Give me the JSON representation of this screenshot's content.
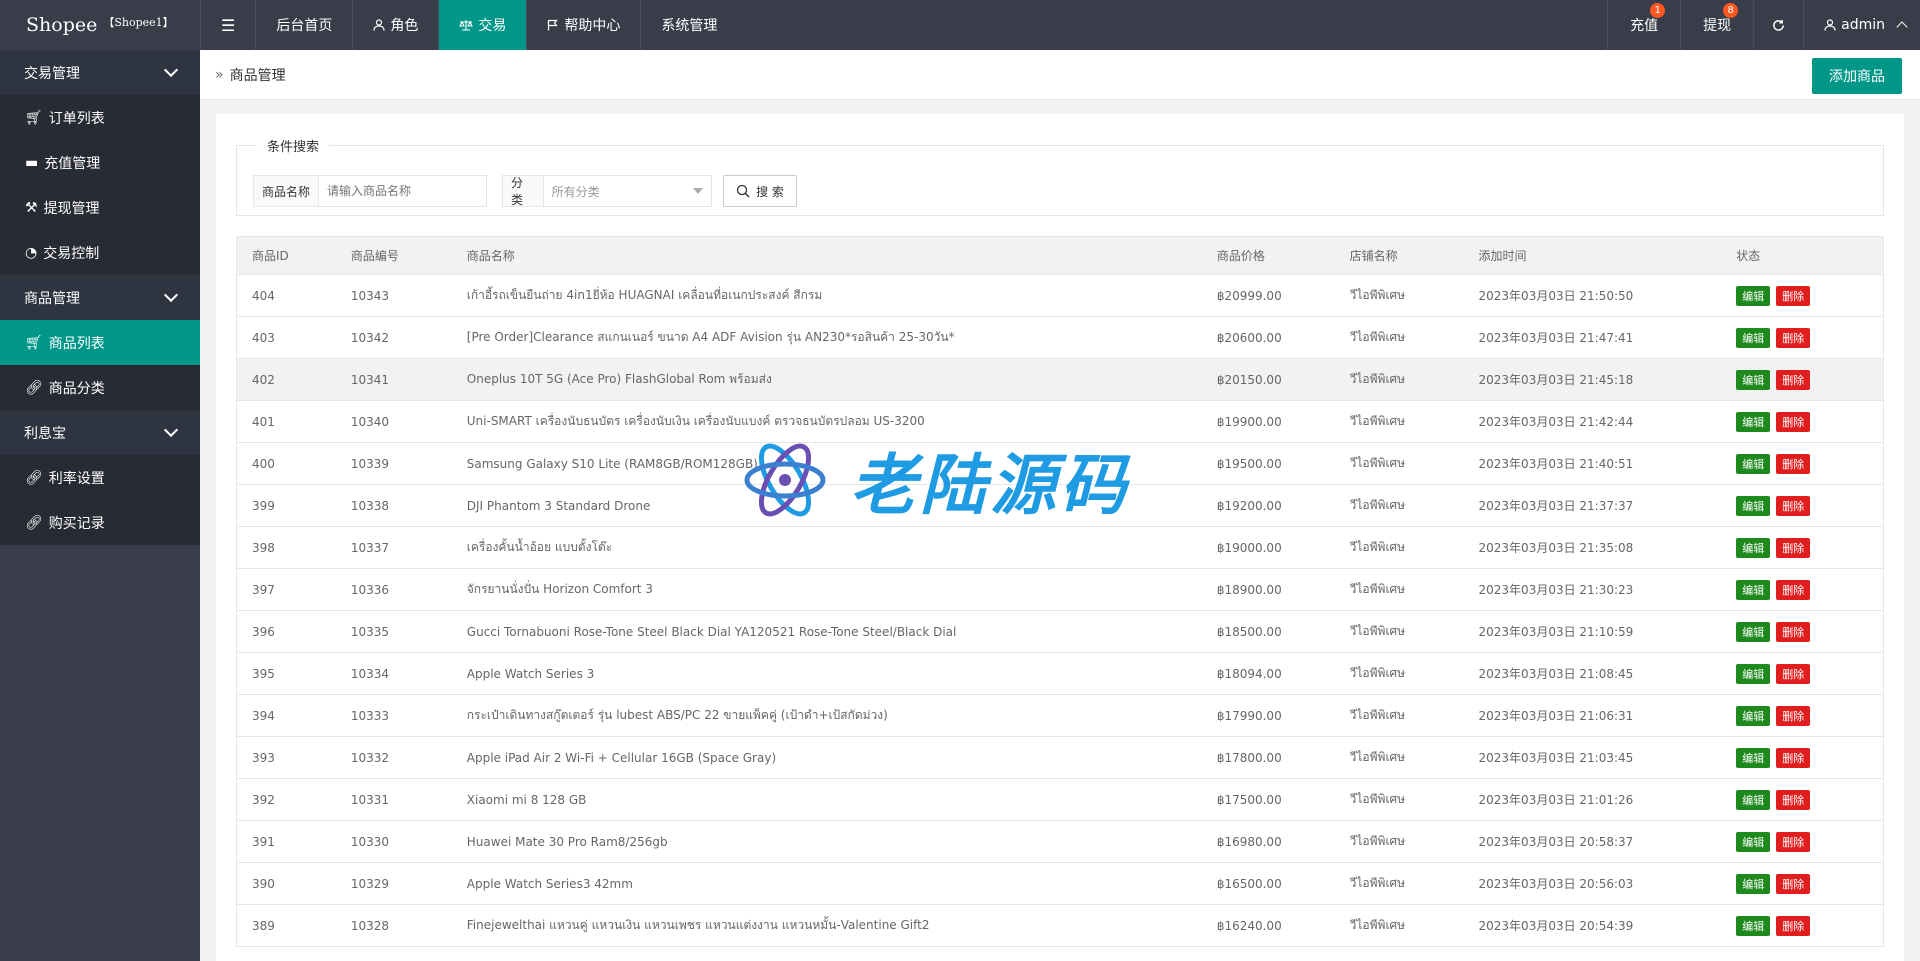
{
  "app": {
    "brand": "Shopee",
    "shop": "【Shopee1】"
  },
  "topnav": {
    "items": [
      {
        "label": "后台首页"
      },
      {
        "label": "角色"
      },
      {
        "label": "交易"
      },
      {
        "label": "帮助中心"
      },
      {
        "label": "系统管理"
      }
    ]
  },
  "topright": {
    "recharge": {
      "label": "充值",
      "badge": "1"
    },
    "withdraw": {
      "label": "提现",
      "badge": "8"
    },
    "user": "admin"
  },
  "sidebar": {
    "groups": [
      {
        "label": "交易管理",
        "items": [
          "订单列表",
          "充值管理",
          "提现管理",
          "交易控制"
        ]
      },
      {
        "label": "商品管理",
        "items": [
          "商品列表",
          "商品分类"
        ]
      },
      {
        "label": "利息宝",
        "items": [
          "利率设置",
          "购买记录"
        ]
      }
    ]
  },
  "crumb": {
    "title": "商品管理",
    "add_button": "添加商品"
  },
  "search": {
    "legend": "条件搜索",
    "name_label": "商品名称",
    "name_placeholder": "请输入商品名称",
    "cat_label": "分类",
    "cat_value": "所有分类",
    "button": "搜 索"
  },
  "table": {
    "headers": [
      "商品ID",
      "商品编号",
      "商品名称",
      "商品价格",
      "店铺名称",
      "添加时间",
      "状态"
    ],
    "rows": [
      {
        "id": "404",
        "code": "10343",
        "name": "เก้าอี้รถเข็นยืนถ่าย 4in1ยี่ห้อ HUAGNAI เคลื่อนที่อเนกประสงค์ สีกรม",
        "price": "฿20999.00",
        "store": "วีไอพีพิเศษ",
        "time": "2023年03月03日 21:50:50"
      },
      {
        "id": "403",
        "code": "10342",
        "name": "[Pre Order]Clearance สแกนเนอร์ ขนาด A4 ADF Avision รุ่น AN230*รอสินค้า 25-30วัน*",
        "price": "฿20600.00",
        "store": "วีไอพีพิเศษ",
        "time": "2023年03月03日 21:47:41"
      },
      {
        "id": "402",
        "code": "10341",
        "name": "Oneplus 10T 5G (Ace Pro) FlashGlobal Rom พร้อมส่ง",
        "price": "฿20150.00",
        "store": "วีไอพีพิเศษ",
        "time": "2023年03月03日 21:45:18"
      },
      {
        "id": "401",
        "code": "10340",
        "name": "Uni-SMART เครื่องนับธนบัตร เครื่องนับเงิน เครื่องนับแบงค์ ตรวจธนบัตรปลอม US-3200",
        "price": "฿19900.00",
        "store": "วีไอพีพิเศษ",
        "time": "2023年03月03日 21:42:44"
      },
      {
        "id": "400",
        "code": "10339",
        "name": "Samsung Galaxy S10 Lite (RAM8GB/ROM128GB)",
        "price": "฿19500.00",
        "store": "วีไอพีพิเศษ",
        "time": "2023年03月03日 21:40:51"
      },
      {
        "id": "399",
        "code": "10338",
        "name": "DJI Phantom 3 Standard Drone",
        "price": "฿19200.00",
        "store": "วีไอพีพิเศษ",
        "time": "2023年03月03日 21:37:37"
      },
      {
        "id": "398",
        "code": "10337",
        "name": "เครื่องคั้นน้ำอ้อย แบบตั้งโต๊ะ",
        "price": "฿19000.00",
        "store": "วีไอพีพิเศษ",
        "time": "2023年03月03日 21:35:08"
      },
      {
        "id": "397",
        "code": "10336",
        "name": "จักรยานนั่งปั่น Horizon Comfort 3",
        "price": "฿18900.00",
        "store": "วีไอพีพิเศษ",
        "time": "2023年03月03日 21:30:23"
      },
      {
        "id": "396",
        "code": "10335",
        "name": "Gucci Tornabuoni Rose-Tone Steel Black Dial YA120521 Rose-Tone Steel/Black Dial",
        "price": "฿18500.00",
        "store": "วีไอพีพิเศษ",
        "time": "2023年03月03日 21:10:59"
      },
      {
        "id": "395",
        "code": "10334",
        "name": "Apple Watch Series 3",
        "price": "฿18094.00",
        "store": "วีไอพีพิเศษ",
        "time": "2023年03月03日 21:08:45"
      },
      {
        "id": "394",
        "code": "10333",
        "name": "กระเป๋าเดินทางสกู๊ตเตอร์ รุ่น lubest ABS/PC 22 ขายแพ็คคู่ (เป้าดำ+เป้สกัดม่วง)",
        "price": "฿17990.00",
        "store": "วีไอพีพิเศษ",
        "time": "2023年03月03日 21:06:31"
      },
      {
        "id": "393",
        "code": "10332",
        "name": "Apple iPad Air 2 Wi-Fi + Cellular 16GB (Space Gray)",
        "price": "฿17800.00",
        "store": "วีไอพีพิเศษ",
        "time": "2023年03月03日 21:03:45"
      },
      {
        "id": "392",
        "code": "10331",
        "name": "Xiaomi mi 8 128 GB",
        "price": "฿17500.00",
        "store": "วีไอพีพิเศษ",
        "time": "2023年03月03日 21:01:26"
      },
      {
        "id": "391",
        "code": "10330",
        "name": "Huawei Mate 30 Pro Ram8/256gb",
        "price": "฿16980.00",
        "store": "วีไอพีพิเศษ",
        "time": "2023年03月03日 20:58:37"
      },
      {
        "id": "390",
        "code": "10329",
        "name": "Apple Watch Series3 42mm",
        "price": "฿16500.00",
        "store": "วีไอพีพิเศษ",
        "time": "2023年03月03日 20:56:03"
      },
      {
        "id": "389",
        "code": "10328",
        "name": "Finejewelthai แหวนคู่ แหวนเงิน แหวนเพชร แหวนแต่งงาน แหวนหมั้น-Valentine Gift2",
        "price": "฿16240.00",
        "store": "วีไอพีพิเศษ",
        "time": "2023年03月03日 20:54:39"
      }
    ],
    "edit_label": "编辑",
    "delete_label": "删除"
  },
  "watermark": {
    "text": "老陆源码"
  },
  "colors": {
    "accent": "#009688",
    "dark": "#393d49",
    "edit": "#1e8a1e",
    "delete": "#e01e1e"
  }
}
